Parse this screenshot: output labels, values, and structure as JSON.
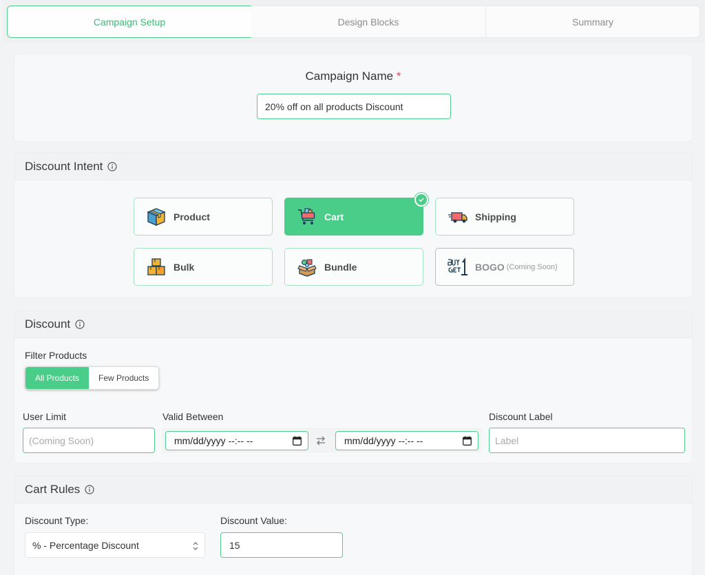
{
  "tabs": [
    {
      "label": "Campaign Setup",
      "active": true
    },
    {
      "label": "Design Blocks",
      "active": false
    },
    {
      "label": "Summary",
      "active": false
    }
  ],
  "campaign": {
    "label": "Campaign Name",
    "required_mark": "*",
    "value": "20% off on all products Discount"
  },
  "intent": {
    "title": "Discount Intent",
    "options": [
      {
        "label": "Product",
        "icon": "box-icon"
      },
      {
        "label": "Cart",
        "icon": "shopping-cart-icon",
        "selected": true
      },
      {
        "label": "Shipping",
        "icon": "delivery-truck-icon"
      },
      {
        "label": "Bulk",
        "icon": "stacked-boxes-icon"
      },
      {
        "label": "Bundle",
        "icon": "bundle-box-icon"
      },
      {
        "label": "BOGO",
        "note": "(Coming Soon)",
        "icon": "buy-get-one-icon",
        "disabled": true
      }
    ]
  },
  "discount": {
    "title": "Discount",
    "filter_label": "Filter Products",
    "filter_options": [
      "All Products",
      "Few Products"
    ],
    "filter_selected": "All Products",
    "user_limit": {
      "label": "User Limit",
      "placeholder": "(Coming Soon)"
    },
    "valid_between": {
      "label": "Valid Between",
      "start": "mm/dd/yyyy --:-- --",
      "end": "mm/dd/yyyy --:-- --"
    },
    "discount_label": {
      "label": "Discount Label",
      "placeholder": "Label"
    }
  },
  "cart_rules": {
    "title": "Cart Rules",
    "type_label": "Discount Type:",
    "type_value": "% - Percentage Discount",
    "value_label": "Discount Value:",
    "value": "15"
  },
  "colors": {
    "accent": "#4bcd8a",
    "required": "#e24a4a"
  }
}
